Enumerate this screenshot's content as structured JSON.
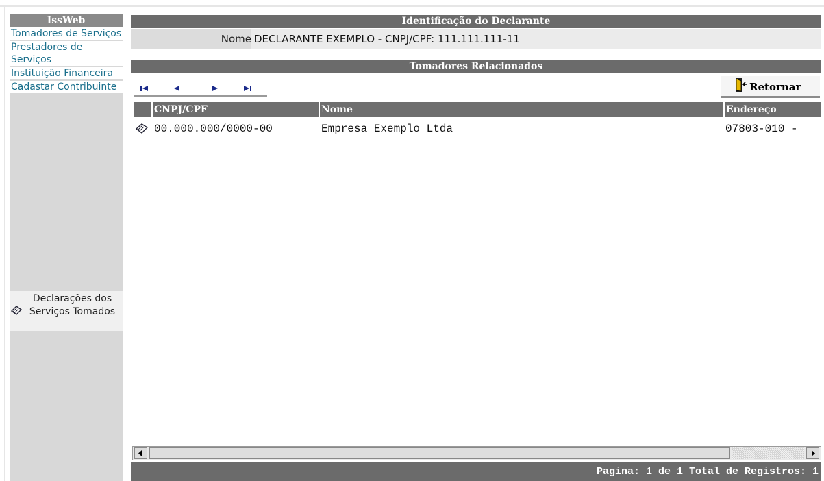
{
  "sidebar": {
    "title": "IssWeb",
    "links": [
      "Tomadores de Serviços",
      "Prestadores de Serviços",
      "Instituição Financeira",
      "Cadastar Contribuinte"
    ],
    "declaracoes_label": "Declarações dos Serviços Tomados"
  },
  "identificacao": {
    "title": "Identificação do Declarante",
    "label": "Nome",
    "value": "DECLARANTE EXEMPLO - CNPJ/CPF: 111.111.111-11"
  },
  "tomadores": {
    "title": "Tomadores Relacionados",
    "retornar_label": "Retornar"
  },
  "navigation": {
    "icons": [
      "first-page-icon",
      "previous-page-icon",
      "next-page-icon",
      "last-page-icon"
    ]
  },
  "table": {
    "columns": [
      "CNPJ/CPF",
      "Nome",
      "Endereço"
    ],
    "rows": [
      {
        "cnpj": "00.000.000/0000-00",
        "nome": "Empresa Exemplo Ltda",
        "endereco": "07803-010 -"
      }
    ]
  },
  "footer": {
    "text": "Pagina: 1 de 1 Total de Registros: 1"
  },
  "colors": {
    "header_gray": "#6b6b6b",
    "link": "#1a6f8c",
    "sidebar_bg": "#d8d8d8"
  }
}
